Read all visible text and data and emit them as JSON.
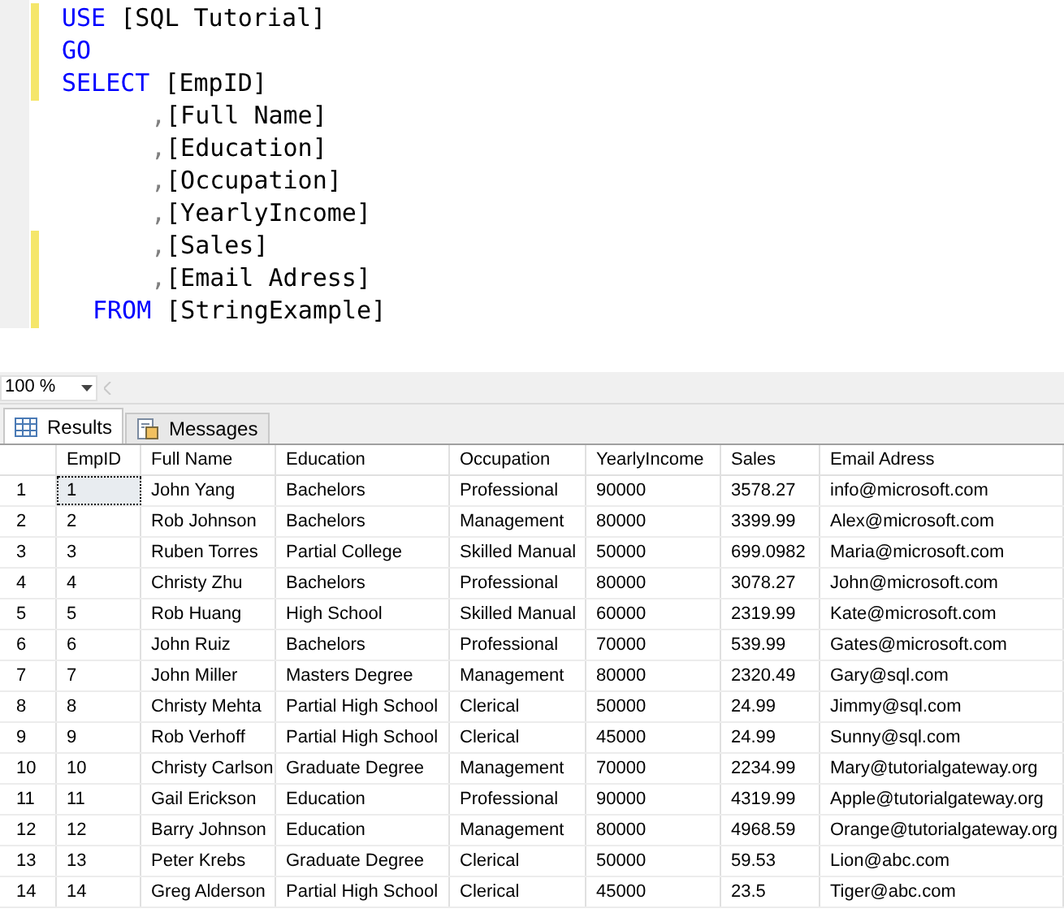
{
  "editor": {
    "lines": [
      {
        "kind": "statement",
        "changed": true,
        "tokens": [
          {
            "kind": "keyword",
            "text": "USE"
          },
          {
            "kind": "plain",
            "text": " [SQL Tutorial]"
          }
        ]
      },
      {
        "kind": "statement",
        "changed": true,
        "tokens": [
          {
            "kind": "keyword",
            "text": "GO"
          }
        ]
      },
      {
        "kind": "statement",
        "changed": true,
        "tokens": [
          {
            "kind": "keyword",
            "text": "SELECT"
          },
          {
            "kind": "plain",
            "text": " [EmpID]"
          }
        ]
      },
      {
        "kind": "column",
        "changed": false,
        "tokens": [
          {
            "kind": "punct",
            "text": ","
          },
          {
            "kind": "plain",
            "text": "[Full Name]"
          }
        ]
      },
      {
        "kind": "column",
        "changed": false,
        "tokens": [
          {
            "kind": "punct",
            "text": ","
          },
          {
            "kind": "plain",
            "text": "[Education]"
          }
        ]
      },
      {
        "kind": "column",
        "changed": false,
        "tokens": [
          {
            "kind": "punct",
            "text": ","
          },
          {
            "kind": "plain",
            "text": "[Occupation]"
          }
        ]
      },
      {
        "kind": "column",
        "changed": false,
        "tokens": [
          {
            "kind": "punct",
            "text": ","
          },
          {
            "kind": "plain",
            "text": "[YearlyIncome]"
          }
        ]
      },
      {
        "kind": "column",
        "changed": true,
        "tokens": [
          {
            "kind": "punct",
            "text": ","
          },
          {
            "kind": "plain",
            "text": "[Sales]"
          }
        ]
      },
      {
        "kind": "column",
        "changed": true,
        "tokens": [
          {
            "kind": "punct",
            "text": ","
          },
          {
            "kind": "plain",
            "text": "[Email Adress]"
          }
        ]
      },
      {
        "kind": "clause",
        "changed": true,
        "tokens": [
          {
            "kind": "keyword",
            "text": "FROM"
          },
          {
            "kind": "plain",
            "text": " [StringExample]"
          }
        ]
      }
    ]
  },
  "zoom": {
    "value": "100 %"
  },
  "tabs": [
    {
      "label": "Results",
      "selected": true
    },
    {
      "label": "Messages",
      "selected": false
    }
  ],
  "grid": {
    "columns": [
      "EmpID",
      "Full Name",
      "Education",
      "Occupation",
      "YearlyIncome",
      "Sales",
      "Email Adress"
    ],
    "rows": [
      {
        "number": "1",
        "focused": true,
        "cells": [
          "1",
          "John Yang",
          "Bachelors",
          "Professional",
          "90000",
          "3578.27",
          "info@microsoft.com"
        ]
      },
      {
        "number": "2",
        "focused": false,
        "cells": [
          "2",
          "Rob Johnson",
          "Bachelors",
          "Management",
          "80000",
          "3399.99",
          "Alex@microsoft.com"
        ]
      },
      {
        "number": "3",
        "focused": false,
        "cells": [
          "3",
          "Ruben Torres",
          "Partial College",
          "Skilled Manual",
          "50000",
          "699.0982",
          "Maria@microsoft.com"
        ]
      },
      {
        "number": "4",
        "focused": false,
        "cells": [
          "4",
          "Christy Zhu",
          "Bachelors",
          "Professional",
          "80000",
          "3078.27",
          "John@microsoft.com"
        ]
      },
      {
        "number": "5",
        "focused": false,
        "cells": [
          "5",
          "Rob Huang",
          "High School",
          "Skilled Manual",
          "60000",
          "2319.99",
          "Kate@microsoft.com"
        ]
      },
      {
        "number": "6",
        "focused": false,
        "cells": [
          "6",
          "John Ruiz",
          "Bachelors",
          "Professional",
          "70000",
          "539.99",
          "Gates@microsoft.com"
        ]
      },
      {
        "number": "7",
        "focused": false,
        "cells": [
          "7",
          "John Miller",
          "Masters Degree",
          "Management",
          "80000",
          "2320.49",
          "Gary@sql.com"
        ]
      },
      {
        "number": "8",
        "focused": false,
        "cells": [
          "8",
          "Christy Mehta",
          "Partial High School",
          "Clerical",
          "50000",
          "24.99",
          "Jimmy@sql.com"
        ]
      },
      {
        "number": "9",
        "focused": false,
        "cells": [
          "9",
          "Rob Verhoff",
          "Partial High School",
          "Clerical",
          "45000",
          "24.99",
          "Sunny@sql.com"
        ]
      },
      {
        "number": "10",
        "focused": false,
        "cells": [
          "10",
          "Christy Carlson",
          "Graduate Degree",
          "Management",
          "70000",
          "2234.99",
          "Mary@tutorialgateway.org"
        ]
      },
      {
        "number": "11",
        "focused": false,
        "cells": [
          "11",
          "Gail Erickson",
          "Education",
          "Professional",
          "90000",
          "4319.99",
          "Apple@tutorialgateway.org"
        ]
      },
      {
        "number": "12",
        "focused": false,
        "cells": [
          "12",
          "Barry Johnson",
          "Education",
          "Management",
          "80000",
          "4968.59",
          "Orange@tutorialgateway.org"
        ]
      },
      {
        "number": "13",
        "focused": false,
        "cells": [
          "13",
          "Peter Krebs",
          "Graduate Degree",
          "Clerical",
          "50000",
          "59.53",
          "Lion@abc.com"
        ]
      },
      {
        "number": "14",
        "focused": false,
        "cells": [
          "14",
          "Greg Alderson",
          "Partial High School",
          "Clerical",
          "45000",
          "23.5",
          "Tiger@abc.com"
        ]
      }
    ]
  }
}
